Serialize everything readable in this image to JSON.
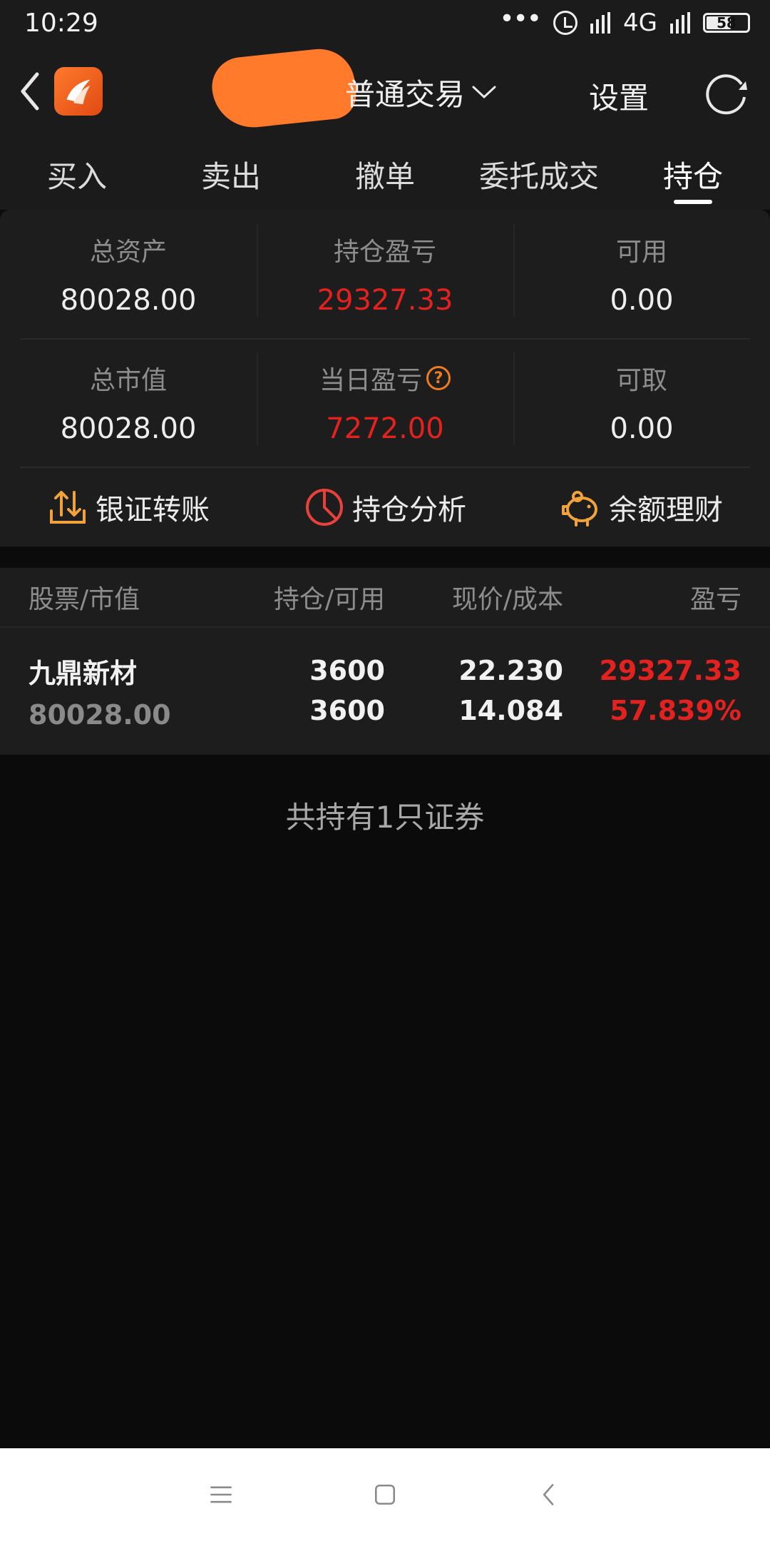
{
  "status_bar": {
    "time": "10:29",
    "network": "4G",
    "battery": "58"
  },
  "header": {
    "account_title": "普通交易",
    "settings_label": "设置"
  },
  "tabs": [
    {
      "label": "买入",
      "active": false
    },
    {
      "label": "卖出",
      "active": false
    },
    {
      "label": "撤单",
      "active": false
    },
    {
      "label": "委托成交",
      "active": false
    },
    {
      "label": "持仓",
      "active": true
    }
  ],
  "summary": {
    "total_assets": {
      "label": "总资产",
      "value": "80028.00"
    },
    "position_pnl": {
      "label": "持仓盈亏",
      "value": "29327.33"
    },
    "available": {
      "label": "可用",
      "value": "0.00"
    },
    "market_value": {
      "label": "总市值",
      "value": "80028.00"
    },
    "daily_pnl": {
      "label": "当日盈亏",
      "value": "7272.00"
    },
    "withdrawable": {
      "label": "可取",
      "value": "0.00"
    }
  },
  "actions": [
    {
      "label": "银证转账",
      "icon": "transfer-icon"
    },
    {
      "label": "持仓分析",
      "icon": "pie-chart-icon"
    },
    {
      "label": "余额理财",
      "icon": "piggy-bank-icon"
    }
  ],
  "table": {
    "headers": [
      "股票/市值",
      "持仓/可用",
      "现价/成本",
      "盈亏"
    ],
    "rows": [
      {
        "name": "九鼎新材",
        "market_value": "80028.00",
        "position": "3600",
        "available": "3600",
        "price": "22.230",
        "cost": "14.084",
        "pnl": "29327.33",
        "pnl_pct": "57.839%"
      }
    ]
  },
  "count_note": "共持有1只证券",
  "colors": {
    "background": "#0b0b0b",
    "panel": "#1d1d1d",
    "profit_red": "#e3221f",
    "accent_orange": "#f07a20"
  }
}
